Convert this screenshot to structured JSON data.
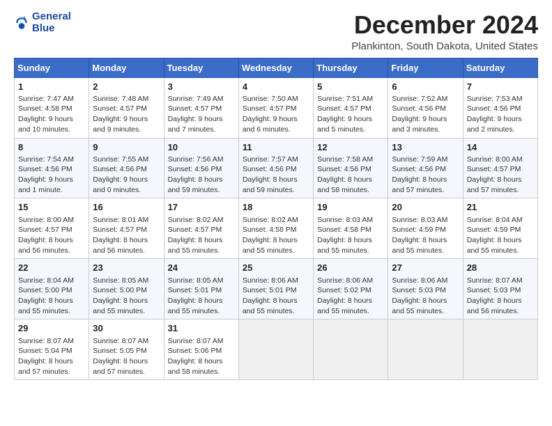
{
  "logo": {
    "line1": "General",
    "line2": "Blue"
  },
  "title": "December 2024",
  "subtitle": "Plankinton, South Dakota, United States",
  "headers": [
    "Sunday",
    "Monday",
    "Tuesday",
    "Wednesday",
    "Thursday",
    "Friday",
    "Saturday"
  ],
  "weeks": [
    [
      {
        "day": "1",
        "info": "Sunrise: 7:47 AM\nSunset: 4:58 PM\nDaylight: 9 hours\nand 10 minutes."
      },
      {
        "day": "2",
        "info": "Sunrise: 7:48 AM\nSunset: 4:57 PM\nDaylight: 9 hours\nand 9 minutes."
      },
      {
        "day": "3",
        "info": "Sunrise: 7:49 AM\nSunset: 4:57 PM\nDaylight: 9 hours\nand 7 minutes."
      },
      {
        "day": "4",
        "info": "Sunrise: 7:50 AM\nSunset: 4:57 PM\nDaylight: 9 hours\nand 6 minutes."
      },
      {
        "day": "5",
        "info": "Sunrise: 7:51 AM\nSunset: 4:57 PM\nDaylight: 9 hours\nand 5 minutes."
      },
      {
        "day": "6",
        "info": "Sunrise: 7:52 AM\nSunset: 4:56 PM\nDaylight: 9 hours\nand 3 minutes."
      },
      {
        "day": "7",
        "info": "Sunrise: 7:53 AM\nSunset: 4:56 PM\nDaylight: 9 hours\nand 2 minutes."
      }
    ],
    [
      {
        "day": "8",
        "info": "Sunrise: 7:54 AM\nSunset: 4:56 PM\nDaylight: 9 hours\nand 1 minute."
      },
      {
        "day": "9",
        "info": "Sunrise: 7:55 AM\nSunset: 4:56 PM\nDaylight: 9 hours\nand 0 minutes."
      },
      {
        "day": "10",
        "info": "Sunrise: 7:56 AM\nSunset: 4:56 PM\nDaylight: 8 hours\nand 59 minutes."
      },
      {
        "day": "11",
        "info": "Sunrise: 7:57 AM\nSunset: 4:56 PM\nDaylight: 8 hours\nand 59 minutes."
      },
      {
        "day": "12",
        "info": "Sunrise: 7:58 AM\nSunset: 4:56 PM\nDaylight: 8 hours\nand 58 minutes."
      },
      {
        "day": "13",
        "info": "Sunrise: 7:59 AM\nSunset: 4:56 PM\nDaylight: 8 hours\nand 57 minutes."
      },
      {
        "day": "14",
        "info": "Sunrise: 8:00 AM\nSunset: 4:57 PM\nDaylight: 8 hours\nand 57 minutes."
      }
    ],
    [
      {
        "day": "15",
        "info": "Sunrise: 8:00 AM\nSunset: 4:57 PM\nDaylight: 8 hours\nand 56 minutes."
      },
      {
        "day": "16",
        "info": "Sunrise: 8:01 AM\nSunset: 4:57 PM\nDaylight: 8 hours\nand 56 minutes."
      },
      {
        "day": "17",
        "info": "Sunrise: 8:02 AM\nSunset: 4:57 PM\nDaylight: 8 hours\nand 55 minutes."
      },
      {
        "day": "18",
        "info": "Sunrise: 8:02 AM\nSunset: 4:58 PM\nDaylight: 8 hours\nand 55 minutes."
      },
      {
        "day": "19",
        "info": "Sunrise: 8:03 AM\nSunset: 4:58 PM\nDaylight: 8 hours\nand 55 minutes."
      },
      {
        "day": "20",
        "info": "Sunrise: 8:03 AM\nSunset: 4:59 PM\nDaylight: 8 hours\nand 55 minutes."
      },
      {
        "day": "21",
        "info": "Sunrise: 8:04 AM\nSunset: 4:59 PM\nDaylight: 8 hours\nand 55 minutes."
      }
    ],
    [
      {
        "day": "22",
        "info": "Sunrise: 8:04 AM\nSunset: 5:00 PM\nDaylight: 8 hours\nand 55 minutes."
      },
      {
        "day": "23",
        "info": "Sunrise: 8:05 AM\nSunset: 5:00 PM\nDaylight: 8 hours\nand 55 minutes."
      },
      {
        "day": "24",
        "info": "Sunrise: 8:05 AM\nSunset: 5:01 PM\nDaylight: 8 hours\nand 55 minutes."
      },
      {
        "day": "25",
        "info": "Sunrise: 8:06 AM\nSunset: 5:01 PM\nDaylight: 8 hours\nand 55 minutes."
      },
      {
        "day": "26",
        "info": "Sunrise: 8:06 AM\nSunset: 5:02 PM\nDaylight: 8 hours\nand 55 minutes."
      },
      {
        "day": "27",
        "info": "Sunrise: 8:06 AM\nSunset: 5:03 PM\nDaylight: 8 hours\nand 55 minutes."
      },
      {
        "day": "28",
        "info": "Sunrise: 8:07 AM\nSunset: 5:03 PM\nDaylight: 8 hours\nand 56 minutes."
      }
    ],
    [
      {
        "day": "29",
        "info": "Sunrise: 8:07 AM\nSunset: 5:04 PM\nDaylight: 8 hours\nand 57 minutes."
      },
      {
        "day": "30",
        "info": "Sunrise: 8:07 AM\nSunset: 5:05 PM\nDaylight: 8 hours\nand 57 minutes."
      },
      {
        "day": "31",
        "info": "Sunrise: 8:07 AM\nSunset: 5:06 PM\nDaylight: 8 hours\nand 58 minutes."
      },
      null,
      null,
      null,
      null
    ]
  ]
}
